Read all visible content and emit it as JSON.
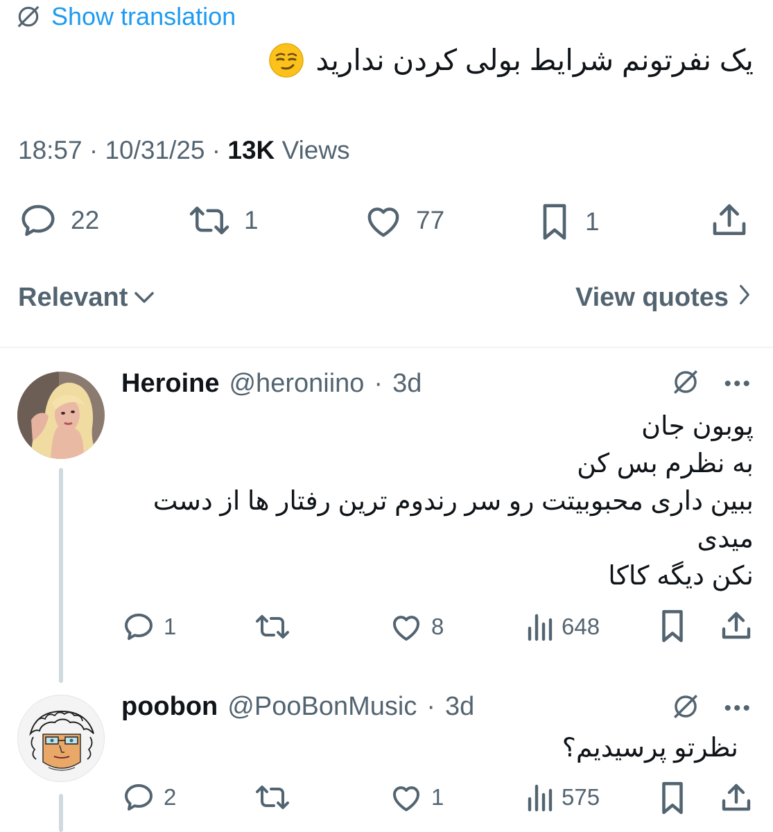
{
  "translation": {
    "label": "Show translation",
    "icon": "globe-slash-icon"
  },
  "tweet": {
    "text": "یک نفرتونم شرایط بولی کردن ندارید",
    "emoji": "smirking-face-emoji",
    "time": "18:57",
    "date": "10/31/25",
    "views_count": "13K",
    "views_label": "Views",
    "separator": "·",
    "stats": {
      "replies": "22",
      "reposts": "1",
      "likes": "77",
      "bookmarks": "1"
    }
  },
  "filters": {
    "sort_label": "Relevant",
    "quotes_label": "View quotes"
  },
  "replies": [
    {
      "name": "Heroine",
      "handle": "@heroniino",
      "time": "3d",
      "lines": [
        "پوبون جان",
        "به نظرم بس کن",
        "ببین داری محبوبیتت رو سر رندوم ترین رفتار ها از دست",
        "میدی",
        "نکن دیگه کاکا"
      ],
      "stats": {
        "replies": "1",
        "likes": "8",
        "views": "648"
      }
    },
    {
      "name": "poobon",
      "handle": "@PooBonMusic",
      "time": "3d",
      "lines": [
        "نظرتو پرسیدیم؟"
      ],
      "stats": {
        "replies": "2",
        "likes": "1",
        "views": "575"
      }
    }
  ],
  "colors": {
    "accent": "#1d9bf0",
    "muted": "#536471",
    "text": "#0f1419",
    "divider": "#eff3f4"
  }
}
